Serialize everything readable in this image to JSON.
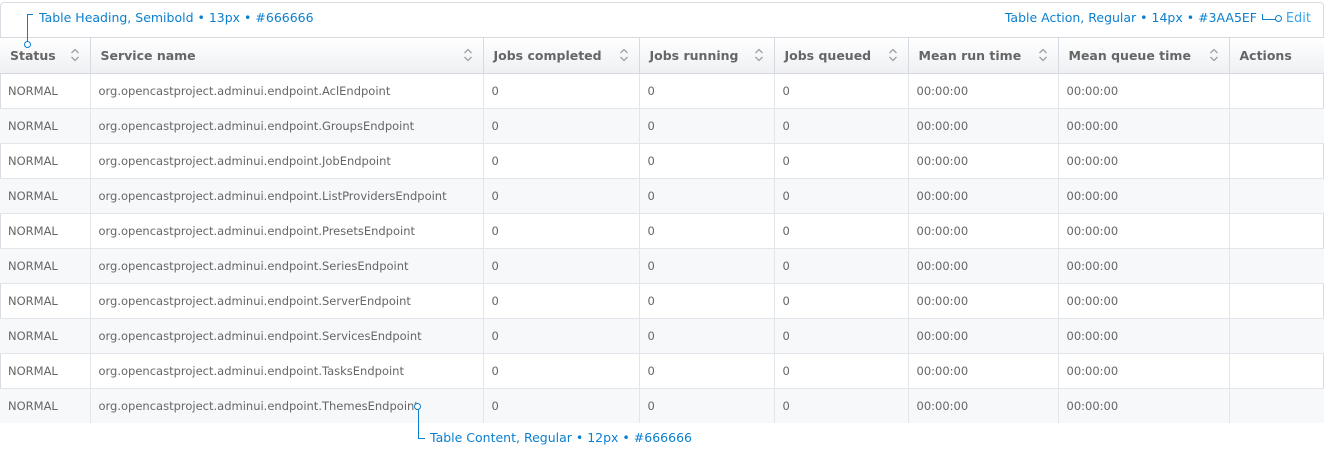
{
  "table": {
    "edit_label": "Edit",
    "headers": [
      {
        "label": "Status",
        "sortable": true
      },
      {
        "label": "Service name",
        "sortable": true
      },
      {
        "label": "Jobs completed",
        "sortable": true
      },
      {
        "label": "Jobs running",
        "sortable": true
      },
      {
        "label": "Jobs queued",
        "sortable": true
      },
      {
        "label": "Mean run time",
        "sortable": true
      },
      {
        "label": "Mean queue time",
        "sortable": true
      },
      {
        "label": "Actions",
        "sortable": false
      }
    ],
    "rows": [
      [
        "NORMAL",
        "org.opencastproject.adminui.endpoint.AclEndpoint",
        "0",
        "0",
        "0",
        "00:00:00",
        "00:00:00",
        ""
      ],
      [
        "NORMAL",
        "org.opencastproject.adminui.endpoint.GroupsEndpoint",
        "0",
        "0",
        "0",
        "00:00:00",
        "00:00:00",
        ""
      ],
      [
        "NORMAL",
        "org.opencastproject.adminui.endpoint.JobEndpoint",
        "0",
        "0",
        "0",
        "00:00:00",
        "00:00:00",
        ""
      ],
      [
        "NORMAL",
        "org.opencastproject.adminui.endpoint.ListProvidersEndpoint",
        "0",
        "0",
        "0",
        "00:00:00",
        "00:00:00",
        ""
      ],
      [
        "NORMAL",
        "org.opencastproject.adminui.endpoint.PresetsEndpoint",
        "0",
        "0",
        "0",
        "00:00:00",
        "00:00:00",
        ""
      ],
      [
        "NORMAL",
        "org.opencastproject.adminui.endpoint.SeriesEndpoint",
        "0",
        "0",
        "0",
        "00:00:00",
        "00:00:00",
        ""
      ],
      [
        "NORMAL",
        "org.opencastproject.adminui.endpoint.ServerEndpoint",
        "0",
        "0",
        "0",
        "00:00:00",
        "00:00:00",
        ""
      ],
      [
        "NORMAL",
        "org.opencastproject.adminui.endpoint.ServicesEndpoint",
        "0",
        "0",
        "0",
        "00:00:00",
        "00:00:00",
        ""
      ],
      [
        "NORMAL",
        "org.opencastproject.adminui.endpoint.TasksEndpoint",
        "0",
        "0",
        "0",
        "00:00:00",
        "00:00:00",
        ""
      ],
      [
        "NORMAL",
        "org.opencastproject.adminui.endpoint.ThemesEndpoint",
        "0",
        "0",
        "0",
        "00:00:00",
        "00:00:00",
        ""
      ]
    ]
  },
  "annotations": {
    "heading": "Table Heading, Semibold • 13px • #666666",
    "action": "Table Action, Regular • 14px • #3AA5EF",
    "content": "Table Content, Regular • 12px • #666666"
  },
  "colors": {
    "annotation": "#0a7fd0",
    "action": "#3AA5EF",
    "text": "#666666"
  },
  "icons": {
    "sort": "sort-arrows-icon"
  }
}
